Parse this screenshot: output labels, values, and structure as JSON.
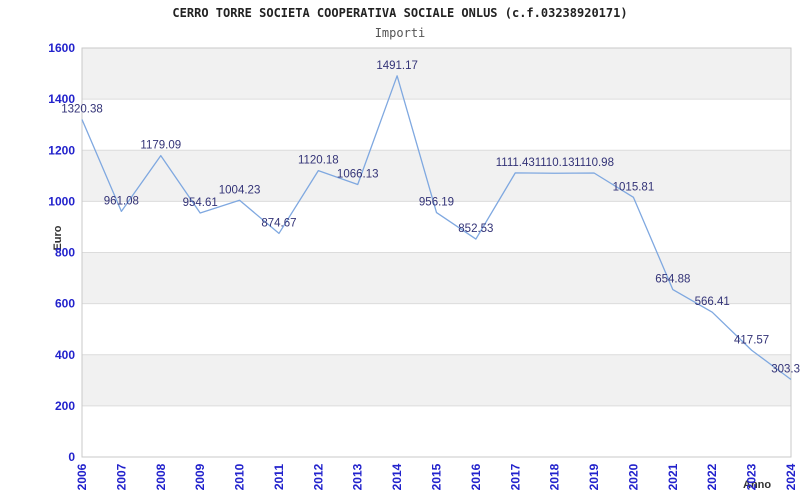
{
  "header": {
    "title": "CERRO TORRE SOCIETA COOPERATIVA SOCIALE ONLUS (c.f.03238920171)",
    "subtitle": "Importi"
  },
  "chart_data": {
    "type": "line",
    "title": "CERRO TORRE SOCIETA COOPERATIVA SOCIALE ONLUS (c.f.03238920171)",
    "subtitle": "Importi",
    "xlabel": "Anno",
    "ylabel": "Euro",
    "categories": [
      "2006",
      "2007",
      "2008",
      "2009",
      "2010",
      "2011",
      "2012",
      "2013",
      "2014",
      "2015",
      "2016",
      "2017",
      "2018",
      "2019",
      "2020",
      "2021",
      "2022",
      "2023",
      "2024"
    ],
    "values": [
      1320.38,
      961.08,
      1179.09,
      954.61,
      1004.23,
      874.67,
      1120.18,
      1066.13,
      1491.17,
      956.19,
      852.53,
      1111.43,
      1110.13,
      1110.98,
      1015.81,
      654.88,
      566.41,
      417.57,
      303.3
    ],
    "point_labels": [
      "1320.38",
      "961.08",
      "1179.09",
      "954.61",
      "1004.23",
      "874.67",
      "1120.18",
      "1066.13",
      "1491.17",
      "956.19",
      "852.53",
      "1111.43",
      "1110.13",
      "1110.98",
      "1015.81",
      "654.88",
      "566.41",
      "417.57",
      "303.3"
    ],
    "ylim": [
      0,
      1600
    ],
    "ytick_step": 200,
    "legend_position": "none",
    "grid": "horizontal-bands-alternating",
    "colors": {
      "line": "#7fa8e0",
      "point_label": "#333377",
      "tick_label": "#2222cc",
      "axis_title": "#333333",
      "band_gray": "#f1f1f1",
      "band_white": "#ffffff",
      "gridline": "#dcdcdc",
      "plot_border": "#c9c9c9",
      "title": "#222222",
      "subtitle": "#555555"
    }
  }
}
